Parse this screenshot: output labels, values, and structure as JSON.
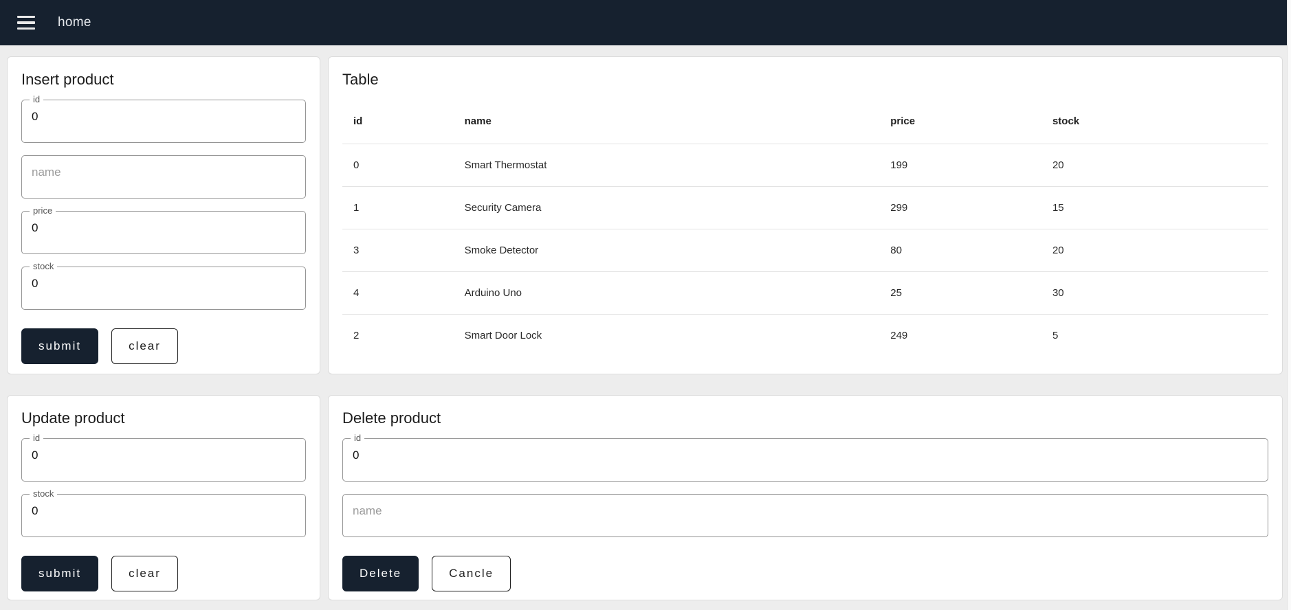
{
  "appbar": {
    "title": "home"
  },
  "colors": {
    "appbar_bg": "#16212f",
    "accent_dark": "#16212f",
    "page_bg": "#ededed",
    "card_border": "#dcdcdc",
    "divider": "#e3e3e3"
  },
  "insert": {
    "title": "Insert product",
    "id_label": "id",
    "id_value": "0",
    "name_placeholder": "name",
    "price_label": "price",
    "price_value": "0",
    "stock_label": "stock",
    "stock_value": "0",
    "submit_label": "submit",
    "clear_label": "clear"
  },
  "table": {
    "title": "Table",
    "columns": {
      "id": "id",
      "name": "name",
      "price": "price",
      "stock": "stock"
    },
    "rows": [
      {
        "id": "0",
        "name": "Smart Thermostat",
        "price": "199",
        "stock": "20"
      },
      {
        "id": "1",
        "name": "Security Camera",
        "price": "299",
        "stock": "15"
      },
      {
        "id": "3",
        "name": "Smoke Detector",
        "price": "80",
        "stock": "20"
      },
      {
        "id": "4",
        "name": "Arduino Uno",
        "price": "25",
        "stock": "30"
      },
      {
        "id": "2",
        "name": "Smart Door Lock",
        "price": "249",
        "stock": "5"
      }
    ]
  },
  "update": {
    "title": "Update product",
    "id_label": "id",
    "id_value": "0",
    "stock_label": "stock",
    "stock_value": "0",
    "submit_label": "submit",
    "clear_label": "clear"
  },
  "delete": {
    "title": "Delete product",
    "id_label": "id",
    "id_value": "0",
    "name_placeholder": "name",
    "delete_label": "Delete",
    "cancel_label": "Cancle"
  }
}
